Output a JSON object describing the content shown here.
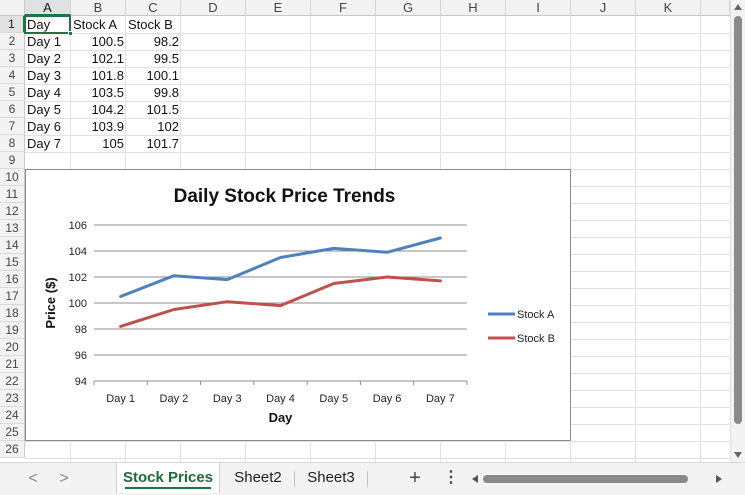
{
  "columns": [
    "A",
    "B",
    "C",
    "D",
    "E",
    "F",
    "G",
    "H",
    "I",
    "J",
    "K"
  ],
  "rows": [
    "1",
    "2",
    "3",
    "4",
    "5",
    "6",
    "7",
    "8",
    "9",
    "10",
    "11",
    "12",
    "13",
    "14",
    "15",
    "16",
    "17",
    "18",
    "19",
    "20",
    "21",
    "22",
    "23",
    "24",
    "25",
    "26"
  ],
  "active_cell": "A1",
  "cells": {
    "headers": [
      "Day",
      "Stock A",
      "Stock B"
    ],
    "data": [
      [
        "Day 1",
        "100.5",
        "98.2"
      ],
      [
        "Day 2",
        "102.1",
        "99.5"
      ],
      [
        "Day 3",
        "101.8",
        "100.1"
      ],
      [
        "Day 4",
        "103.5",
        "99.8"
      ],
      [
        "Day 5",
        "104.2",
        "101.5"
      ],
      [
        "Day 6",
        "103.9",
        "102"
      ],
      [
        "Day 7",
        "105",
        "101.7"
      ]
    ]
  },
  "chart_data": {
    "type": "line",
    "title": "Daily Stock Price Trends",
    "xlabel": "Day",
    "ylabel": "Price ($)",
    "categories": [
      "Day 1",
      "Day 2",
      "Day 3",
      "Day 4",
      "Day 5",
      "Day 6",
      "Day 7"
    ],
    "series": [
      {
        "name": "Stock A",
        "values": [
          100.5,
          102.1,
          101.8,
          103.5,
          104.2,
          103.9,
          105
        ],
        "color": "#4f81bd"
      },
      {
        "name": "Stock B",
        "values": [
          98.2,
          99.5,
          100.1,
          99.8,
          101.5,
          102,
          101.7
        ],
        "color": "#c0504d"
      }
    ],
    "ylim": [
      94,
      106
    ],
    "yticks": [
      94,
      96,
      98,
      100,
      102,
      104,
      106
    ],
    "grid": true,
    "legend": "right"
  },
  "tabs": {
    "nav_prev": "<",
    "nav_next": ">",
    "sheets": [
      {
        "label": "Stock Prices",
        "active": true
      },
      {
        "label": "Sheet2",
        "active": false
      },
      {
        "label": "Sheet3",
        "active": false
      }
    ],
    "add_label": "+",
    "more_label": "⋮"
  },
  "colors": {
    "accent": "#217346",
    "gridline": "#e1e1e1"
  }
}
